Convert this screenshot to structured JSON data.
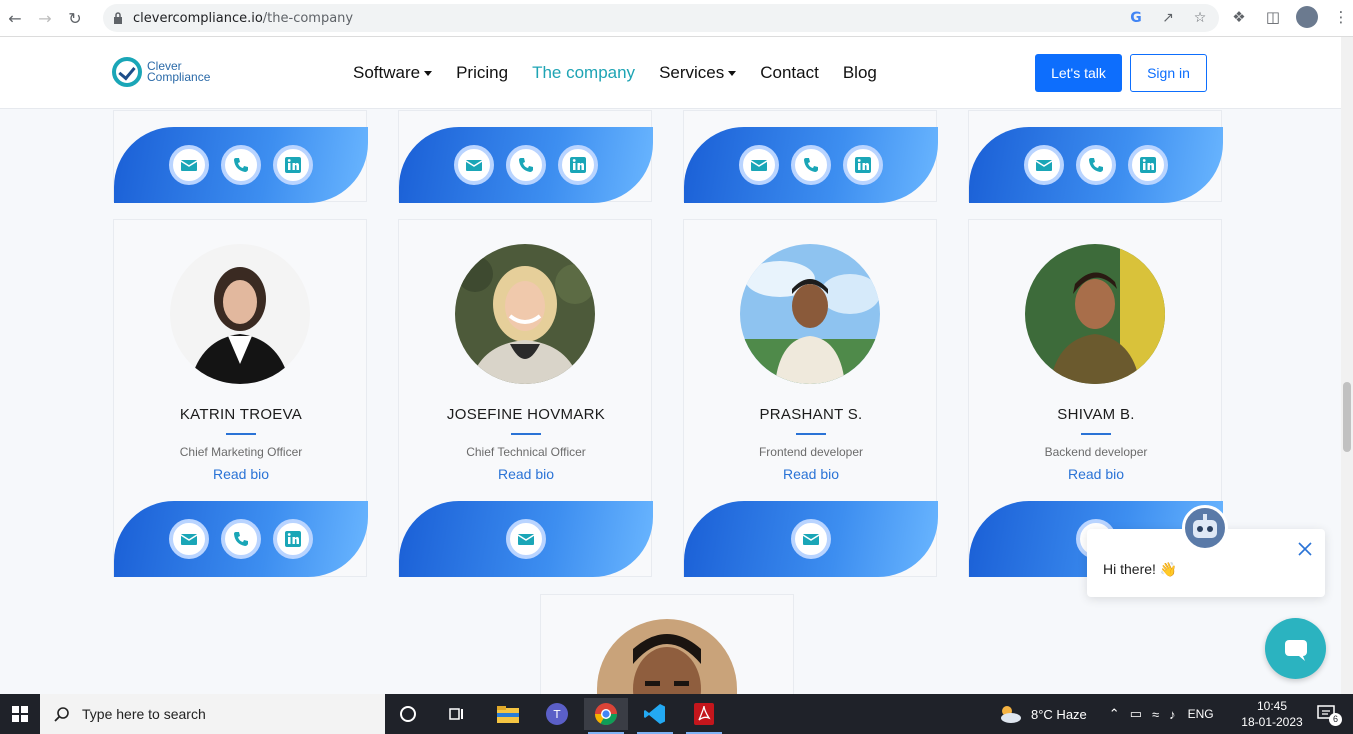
{
  "browser": {
    "url_host": "clevercompliance.io",
    "url_path": "/the-company"
  },
  "site": {
    "logo_line1": "Clever",
    "logo_line2": "Compliance",
    "nav": [
      {
        "label": "Software",
        "dropdown": true
      },
      {
        "label": "Pricing",
        "dropdown": false
      },
      {
        "label": "The company",
        "dropdown": false,
        "active": true
      },
      {
        "label": "Services",
        "dropdown": true
      },
      {
        "label": "Contact",
        "dropdown": false
      },
      {
        "label": "Blog",
        "dropdown": false
      }
    ],
    "cta_primary": "Let's talk",
    "cta_secondary": "Sign in",
    "accent": "#1ea4b4",
    "primary_blue": "#0d6efd"
  },
  "team": [
    {
      "name": "KATRIN TROEVA",
      "role": "Chief Marketing Officer",
      "link": "Read bio",
      "contacts": [
        "mail-icon",
        "phone-icon",
        "linkedin-icon"
      ]
    },
    {
      "name": "JOSEFINE HOVMARK",
      "role": "Chief Technical Officer",
      "link": "Read bio",
      "contacts": [
        "mail-icon"
      ]
    },
    {
      "name": "PRASHANT S.",
      "role": "Frontend developer",
      "link": "Read bio",
      "contacts": [
        "mail-icon"
      ]
    },
    {
      "name": "SHIVAM B.",
      "role": "Backend developer",
      "link": "Read bio",
      "contacts": [
        "mail-icon"
      ]
    }
  ],
  "chat": {
    "greeting": "Hi there! 👋"
  },
  "taskbar": {
    "search_placeholder": "Type here to search",
    "weather": "8°C  Haze",
    "language": "ENG",
    "time": "10:45",
    "date": "18-01-2023",
    "notifications": "6"
  }
}
